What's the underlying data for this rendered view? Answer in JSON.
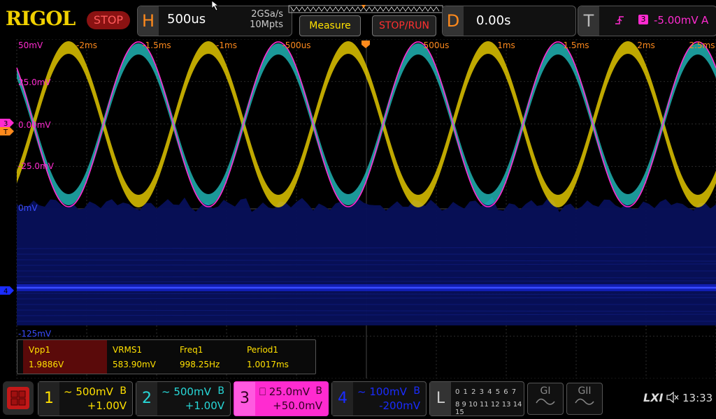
{
  "brand": "RIGOL",
  "run_state": "STOP",
  "horizontal": {
    "letter": "H",
    "timebase": "500us",
    "sample_rate": "2GSa/s",
    "memory_depth": "10Mpts"
  },
  "buttons": {
    "measure": "Measure",
    "stop_run": "STOP/RUN"
  },
  "delay": {
    "letter": "D",
    "value": "0.00s"
  },
  "trigger": {
    "letter": "T",
    "edge_icon": "rising-edge-icon",
    "source": "3",
    "level": "-5.00mV",
    "mode": "A"
  },
  "time_labels": [
    "-2ms",
    "-1.5ms",
    "-1ms",
    "-500us",
    "500us",
    "1ms",
    "1.5ms",
    "2ms",
    "2.5ms"
  ],
  "volt_labels": [
    "50mV",
    "25.0mV",
    "0.00mV",
    "-25.0mV",
    "0mV",
    "-125mV"
  ],
  "markers": {
    "ch3": "3",
    "trig": "T",
    "ch4": "4"
  },
  "measurements": [
    {
      "name": "Vpp1",
      "value": "1.9886V"
    },
    {
      "name": "VRMS1",
      "value": "583.90mV"
    },
    {
      "name": "Freq1",
      "value": "998.25Hz"
    },
    {
      "name": "Period1",
      "value": "1.0017ms"
    }
  ],
  "channels": [
    {
      "num": "1",
      "scale": "500mV",
      "coupling": "B",
      "offset": "+1.00V",
      "color": "#ffe000"
    },
    {
      "num": "2",
      "scale": "500mV",
      "coupling": "B",
      "offset": "+1.00V",
      "color": "#27d8d8"
    },
    {
      "num": "3",
      "scale": "25.0mV",
      "coupling": "B",
      "offset": "+50.0mV",
      "color": "#ff2bd0"
    },
    {
      "num": "4",
      "scale": "100mV",
      "coupling": "B",
      "offset": "-200mV",
      "color": "#1a2cff"
    }
  ],
  "logic": {
    "letter": "L",
    "digits_row1": "0 1 2 3  4 5 6 7",
    "digits_row2": "8 9 10 11 12 13 14 15"
  },
  "gen1": "GI",
  "gen2": "GII",
  "status": {
    "lxi": "LXI",
    "speaker_icon": "speaker-mute-icon",
    "time": "13:33"
  },
  "colors": {
    "ch1": "#ffe000",
    "ch2": "#27d8d8",
    "ch3": "#ff2bd0",
    "ch4": "#1a2cff",
    "accent": "#ff8a1c"
  },
  "chart_data": {
    "type": "line",
    "x_unit": "s",
    "series": [
      {
        "name": "1",
        "function": "sine",
        "frequency_hz": 998.25
      },
      {
        "name": "2",
        "function": "sine",
        "frequency_hz": 998.25,
        "phase": "inverted"
      },
      {
        "name": "3",
        "function": "sine",
        "frequency_hz": 998.25,
        "phase": "inverted"
      },
      {
        "name": "4",
        "function": "noise band"
      }
    ],
    "grid": true
  }
}
